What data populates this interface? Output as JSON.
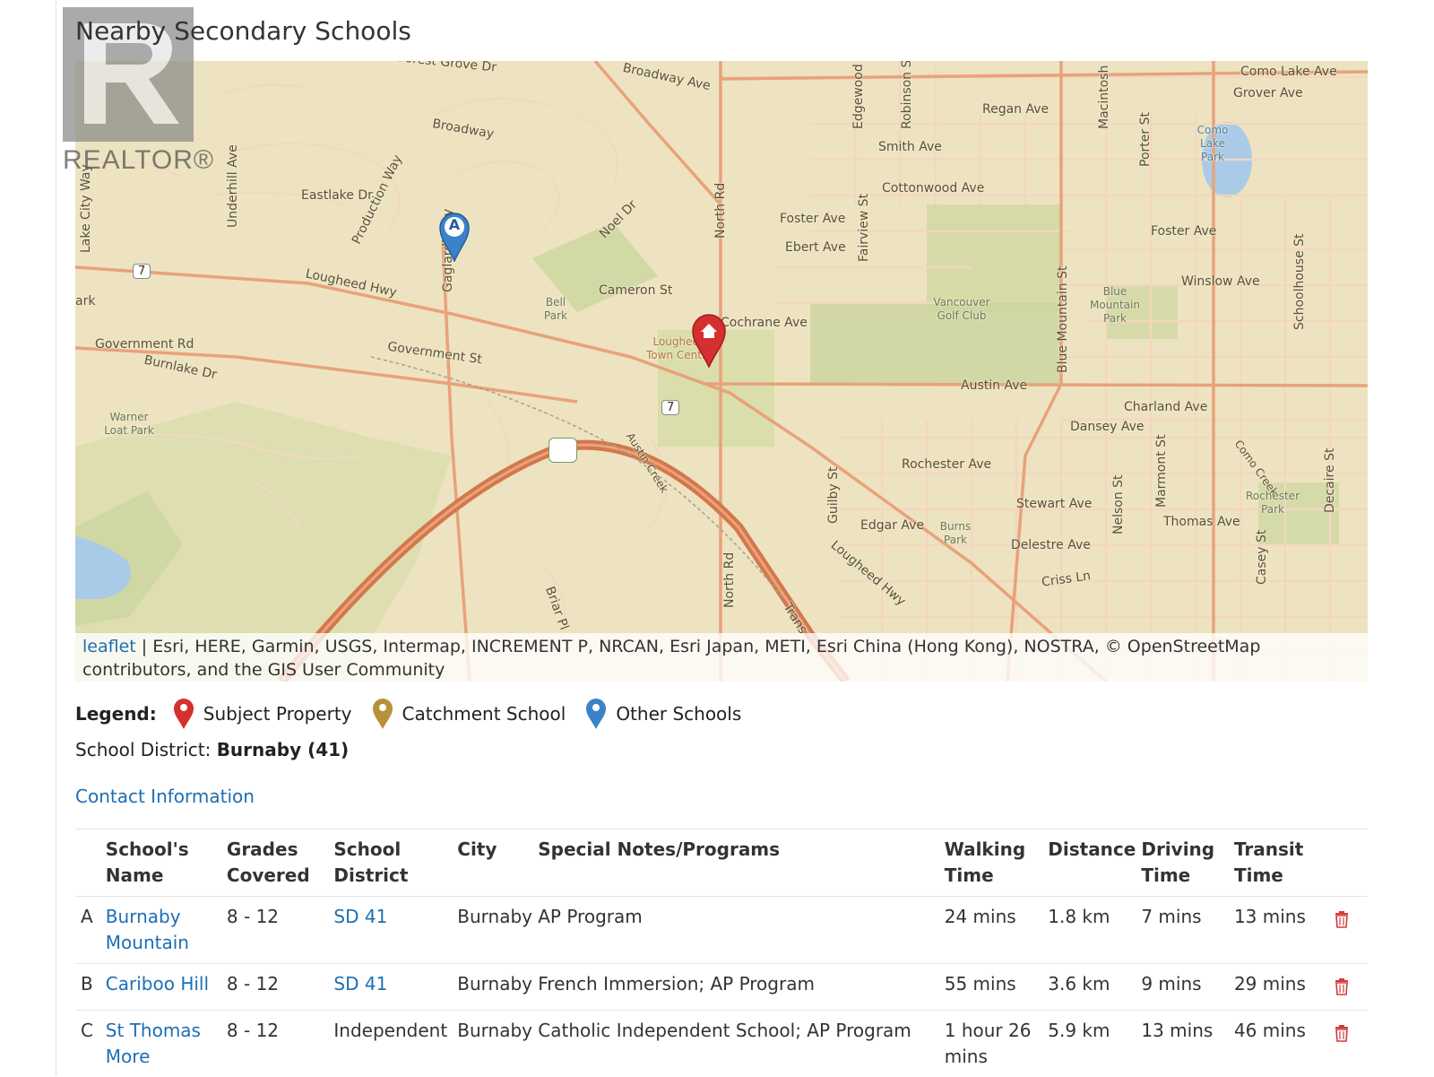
{
  "page": {
    "title": "Nearby Secondary Schools"
  },
  "watermark": {
    "text": "REALTOR®"
  },
  "map": {
    "street_labels": [
      "Forest Grove Dr",
      "Broadway Ave",
      "Broadway",
      "Eastlake Dr",
      "Underhill Ave",
      "Lake City Way",
      "Production Way",
      "Gaglardi Way",
      "Noel Dr",
      "North Rd",
      "Lougheed Hwy",
      "Government Rd",
      "Burnlake Dr",
      "Government St",
      "Cameron St",
      "Cochrane Ave",
      "Austin Ave",
      "Foster Ave",
      "Ebert Ave",
      "Fairview St",
      "Cottonwood Ave",
      "Smith Ave",
      "Regan Ave",
      "Robinson St",
      "Edgewood St",
      "Como Lake Ave",
      "Grover Ave",
      "Foster Ave",
      "Winslow Ave",
      "Porter St",
      "Macintosh",
      "Blue Mountain St",
      "Schoolhouse St",
      "Charland Ave",
      "Dansey Ave",
      "Rochester Ave",
      "Stewart Ave",
      "Thomas Ave",
      "Delestre Ave",
      "Criss Ln",
      "Edgar Ave",
      "Guilby St",
      "Nelson St",
      "Marmont St",
      "Casey St",
      "Decaire St",
      "Austin Creek",
      "Briar Pl",
      "North Rd",
      "Trans",
      "Lougheed Hwy",
      "Como Creek",
      "ark"
    ],
    "park_labels": [
      "Bell Park",
      "Vancouver Golf Club",
      "Blue Mountain Park",
      "Warner Loat Park",
      "Burns Park",
      "Rochester Park",
      "Como Lake Park",
      "Lougheed Town Centre"
    ],
    "route_shields": [
      "7",
      "7"
    ],
    "markers": [
      {
        "type": "other-school",
        "label": "A",
        "color": "#3a82c9"
      },
      {
        "type": "subject-property",
        "color": "#d62f2f"
      }
    ],
    "attribution": {
      "link": "leaflet",
      "text": " | Esri, HERE, Garmin, USGS, Intermap, INCREMENT P, NRCAN, Esri Japan, METI, Esri China (Hong Kong), NOSTRA, © OpenStreetMap contributors, and the GIS User Community"
    }
  },
  "legend": {
    "label": "Legend:",
    "items": [
      {
        "label": "Subject Property",
        "color": "#d62f2f",
        "icon": "map-pin-icon"
      },
      {
        "label": "Catchment School",
        "color": "#b8903c",
        "icon": "map-pin-icon"
      },
      {
        "label": "Other Schools",
        "color": "#3a82c9",
        "icon": "map-pin-icon"
      }
    ]
  },
  "district": {
    "prefix": "School District: ",
    "value": "Burnaby (41)"
  },
  "contact_link": "Contact Information",
  "table": {
    "headers": [
      "School's Name",
      "Grades Covered",
      "School District",
      "City",
      "Special Notes/Programs",
      "Walking Time",
      "Distance",
      "Driving Time",
      "Transit Time"
    ],
    "rows": [
      {
        "letter": "A",
        "name": "Burnaby Mountain",
        "grades": "8 - 12",
        "district": "SD 41",
        "district_link": true,
        "city": "Burnaby",
        "notes": "AP Program",
        "walking": "24 mins",
        "distance": "1.8 km",
        "driving": "7 mins",
        "transit": "13 mins"
      },
      {
        "letter": "B",
        "name": "Cariboo Hill",
        "grades": "8 - 12",
        "district": "SD 41",
        "district_link": true,
        "city": "Burnaby",
        "notes": "French Immersion; AP Program",
        "walking": "55 mins",
        "distance": "3.6 km",
        "driving": "9 mins",
        "transit": "29 mins"
      },
      {
        "letter": "C",
        "name": "St Thomas More",
        "grades": "8 - 12",
        "district": "Independent",
        "district_link": false,
        "city": "Burnaby",
        "notes": "Catholic Independent School; AP Program",
        "walking": "1 hour 26 mins",
        "distance": "5.9 km",
        "driving": "13 mins",
        "transit": "46 mins"
      }
    ]
  },
  "colors": {
    "link": "#1c6fb5",
    "delete": "#d33b3b",
    "map_base": "#ede3c0",
    "park": "#c7d39a",
    "highway": "#d4774a",
    "street": "#e8a27a"
  }
}
